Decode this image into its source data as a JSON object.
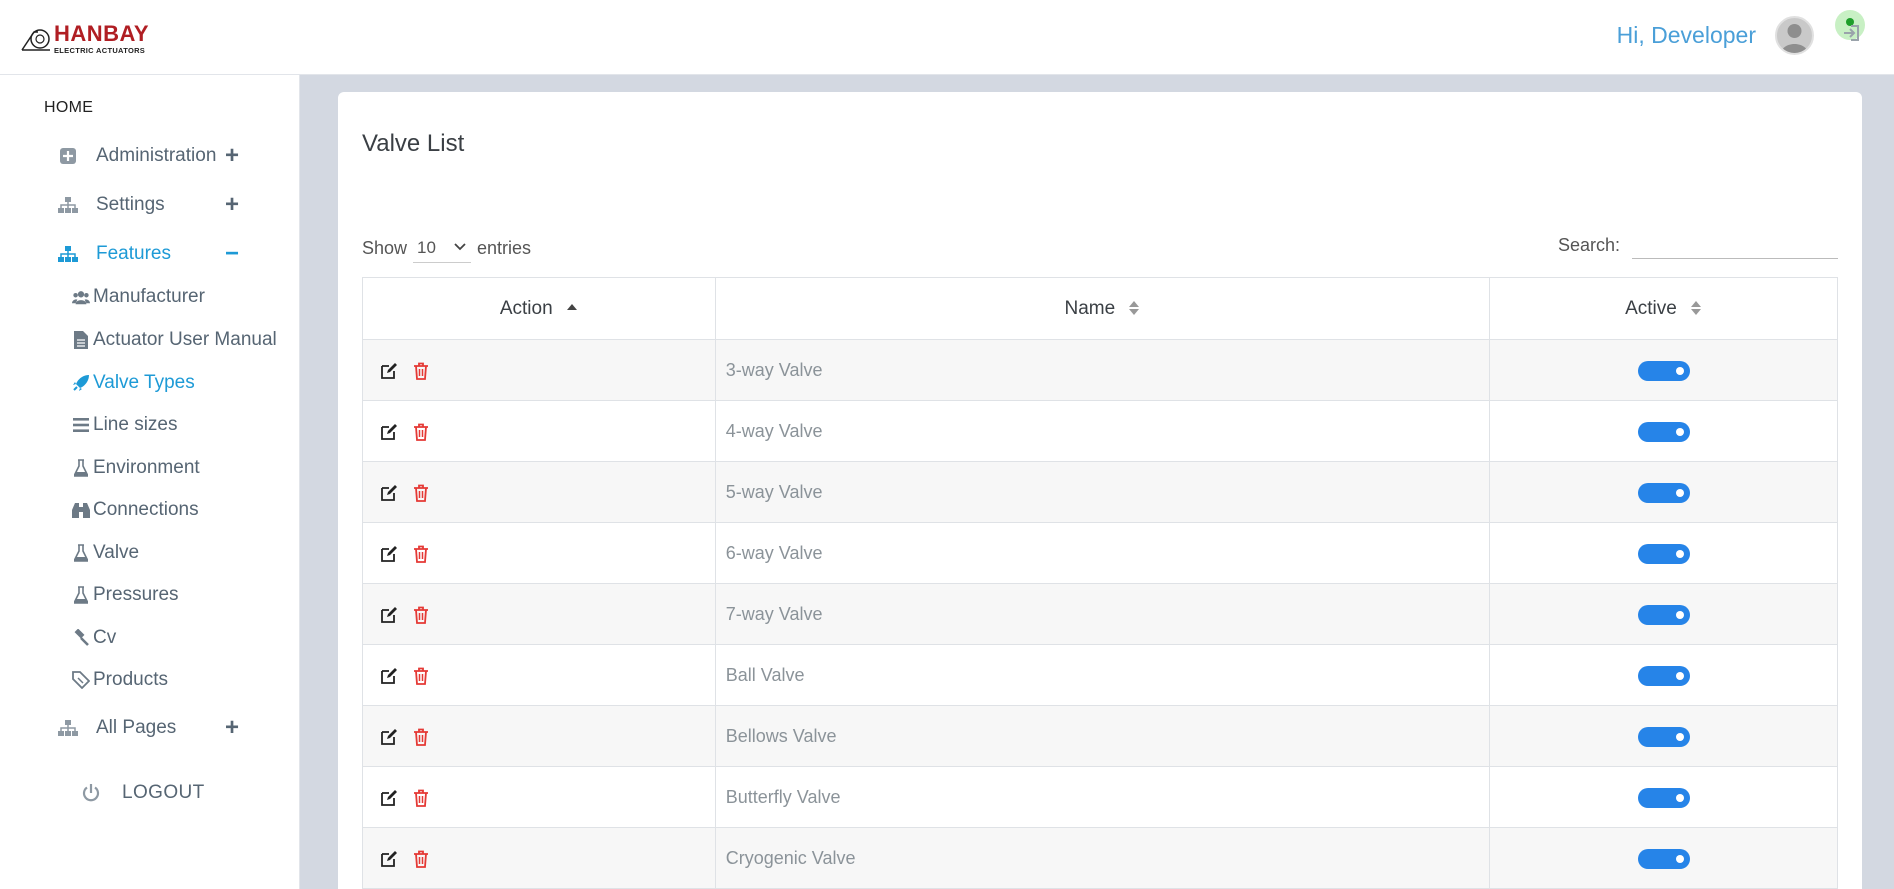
{
  "header": {
    "logo_text": "HANBAY",
    "logo_subtext": "ELECTRIC ACTUATORS",
    "greeting": "Hi, Developer",
    "colors": {
      "brand": "#b01e23",
      "accent": "#4a9fd8"
    }
  },
  "sidebar": {
    "home_label": "HOME",
    "menus": [
      {
        "label": "Administration",
        "icon": "plus-square-icon",
        "toggle": "+"
      },
      {
        "label": "Settings",
        "icon": "sitemap-icon",
        "toggle": "+"
      },
      {
        "label": "Features",
        "icon": "sitemap-icon",
        "toggle": "−",
        "active": true
      }
    ],
    "submenu": [
      {
        "label": "Manufacturer",
        "icon": "users-icon"
      },
      {
        "label": "Actuator User Manual",
        "icon": "file-icon"
      },
      {
        "label": "Valve Types",
        "icon": "rocket-icon",
        "active": true
      },
      {
        "label": "Line sizes",
        "icon": "bars-icon"
      },
      {
        "label": "Environment",
        "icon": "flask-icon"
      },
      {
        "label": "Connections",
        "icon": "binoculars-icon"
      },
      {
        "label": "Valve",
        "icon": "flask-icon"
      },
      {
        "label": "Pressures",
        "icon": "flask-icon"
      },
      {
        "label": "Cv",
        "icon": "gavel-icon"
      },
      {
        "label": "Products",
        "icon": "ticket-icon"
      }
    ],
    "all_pages": {
      "label": "All Pages",
      "icon": "sitemap-icon",
      "toggle": "+"
    },
    "logout_label": "LOGOUT"
  },
  "main": {
    "title": "Valve List",
    "show_label": "Show",
    "entries_value": "10",
    "entries_label": "entries",
    "search_label": "Search:",
    "search_value": "",
    "table": {
      "columns": [
        "Action",
        "Name",
        "Active"
      ],
      "rows": [
        {
          "name": "3-way Valve",
          "active": true
        },
        {
          "name": "4-way Valve",
          "active": true
        },
        {
          "name": "5-way Valve",
          "active": true
        },
        {
          "name": "6-way Valve",
          "active": true
        },
        {
          "name": "7-way Valve",
          "active": true
        },
        {
          "name": "Ball Valve",
          "active": true
        },
        {
          "name": "Bellows Valve",
          "active": true
        },
        {
          "name": "Butterfly Valve",
          "active": true
        },
        {
          "name": "Cryogenic Valve",
          "active": true
        }
      ]
    }
  }
}
